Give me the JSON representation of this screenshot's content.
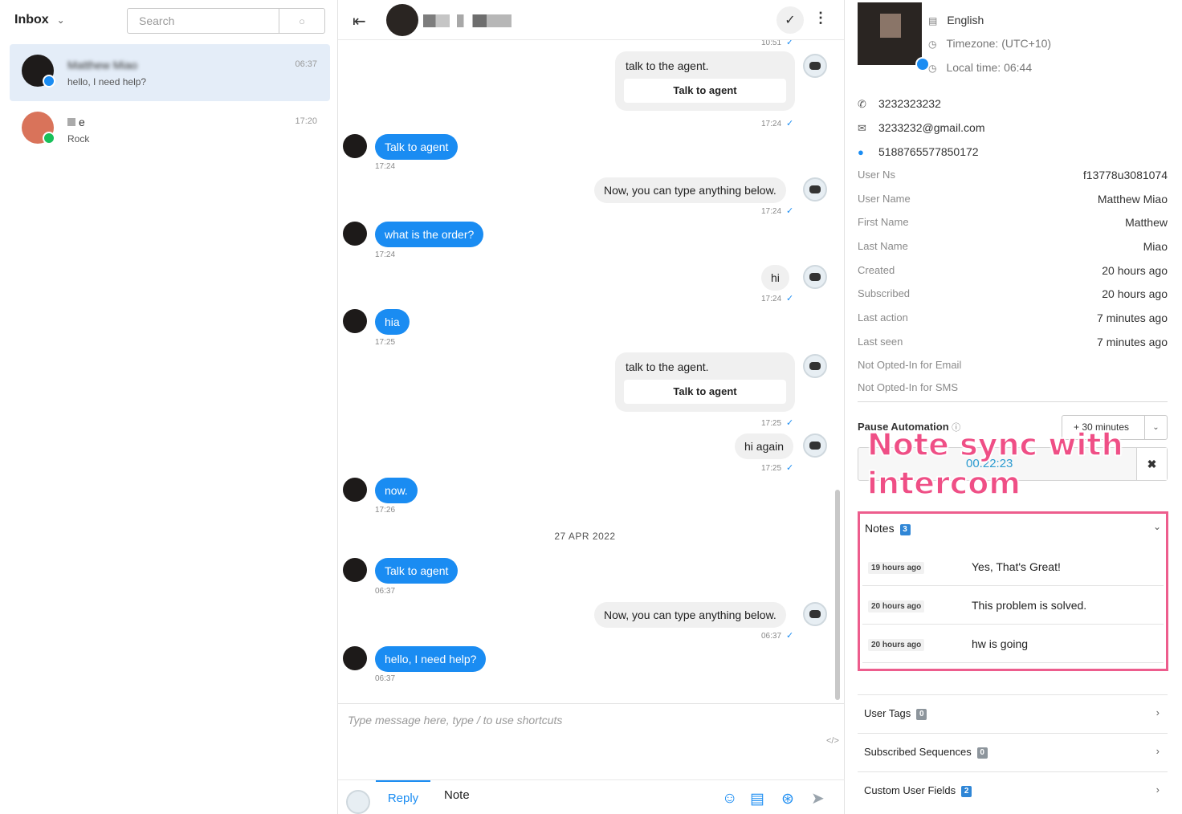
{
  "inbox": {
    "title": "Inbox",
    "search_placeholder": "Search",
    "conversations": [
      {
        "name": "Matthew Miao",
        "preview": "hello, I need help?",
        "time": "06:37",
        "active": true,
        "channel": "messenger"
      },
      {
        "name": "e",
        "preview": "Rock",
        "time": "17:20",
        "active": false,
        "channel": "line"
      }
    ]
  },
  "chat": {
    "top_time": "10:51",
    "messages": [
      {
        "from": "bot",
        "kind": "card",
        "text": "talk to the agent.",
        "button": "Talk to agent",
        "time": "17:24"
      },
      {
        "from": "user",
        "text": "Talk to agent",
        "time": "17:24"
      },
      {
        "from": "bot",
        "text": "Now, you can type anything below.",
        "time": "17:24"
      },
      {
        "from": "user",
        "text": "what is the order?",
        "time": "17:24"
      },
      {
        "from": "bot",
        "text": "hi",
        "time": "17:24"
      },
      {
        "from": "user",
        "text": "hia",
        "time": "17:25"
      },
      {
        "from": "bot",
        "kind": "card",
        "text": "talk to the agent.",
        "button": "Talk to agent",
        "time": "17:25"
      },
      {
        "from": "bot",
        "text": "hi again",
        "time": "17:25"
      },
      {
        "from": "user",
        "text": "now.",
        "time": "17:26"
      },
      {
        "from": "user",
        "text": "Talk to agent",
        "time": "06:37"
      },
      {
        "from": "bot",
        "text": "Now, you can type anything below.",
        "time": "06:37"
      },
      {
        "from": "user",
        "text": "hello, I need help?",
        "time": "06:37"
      }
    ],
    "date_separator": "27 APR 2022",
    "composer_placeholder": "Type message here, type / to use shortcuts",
    "tab_reply": "Reply",
    "tab_note": "Note"
  },
  "profile": {
    "language": "English",
    "timezone": "Timezone: (UTC+10)",
    "local_time": "Local time: 06:44",
    "phone": "3232323232",
    "email": "3233232@gmail.com",
    "messenger_id": "5188765577850172",
    "fields": [
      {
        "label": "User Ns",
        "value": "f13778u3081074"
      },
      {
        "label": "User Name",
        "value": "Matthew Miao"
      },
      {
        "label": "First Name",
        "value": "Matthew"
      },
      {
        "label": "Last Name",
        "value": "Miao"
      },
      {
        "label": "Created",
        "value": "20 hours ago"
      },
      {
        "label": "Subscribed",
        "value": "20 hours ago"
      },
      {
        "label": "Last action",
        "value": "7 minutes ago"
      },
      {
        "label": "Last seen",
        "value": "7 minutes ago"
      }
    ],
    "optout_email": "Not Opted-In for Email",
    "optout_sms": "Not Opted-In for SMS",
    "pause_label": "Pause Automation",
    "pause_value": "+ 30 minutes",
    "timer": "00:22:23",
    "annotation": "Note sync with intercom",
    "notes_label": "Notes",
    "notes_count": "3",
    "notes": [
      {
        "time": "19 hours ago",
        "text": "Yes, That's Great!"
      },
      {
        "time": "20 hours ago",
        "text": "This problem is solved."
      },
      {
        "time": "20 hours ago",
        "text": "hw is going"
      }
    ],
    "sections": [
      {
        "label": "User Tags",
        "count": "0"
      },
      {
        "label": "Subscribed Sequences",
        "count": "0"
      },
      {
        "label": "Custom User Fields",
        "count": "2"
      }
    ]
  },
  "colors": {
    "accent": "#1a8cf2",
    "highlight": "#ed5d8d",
    "active_row": "#e4edf8"
  }
}
